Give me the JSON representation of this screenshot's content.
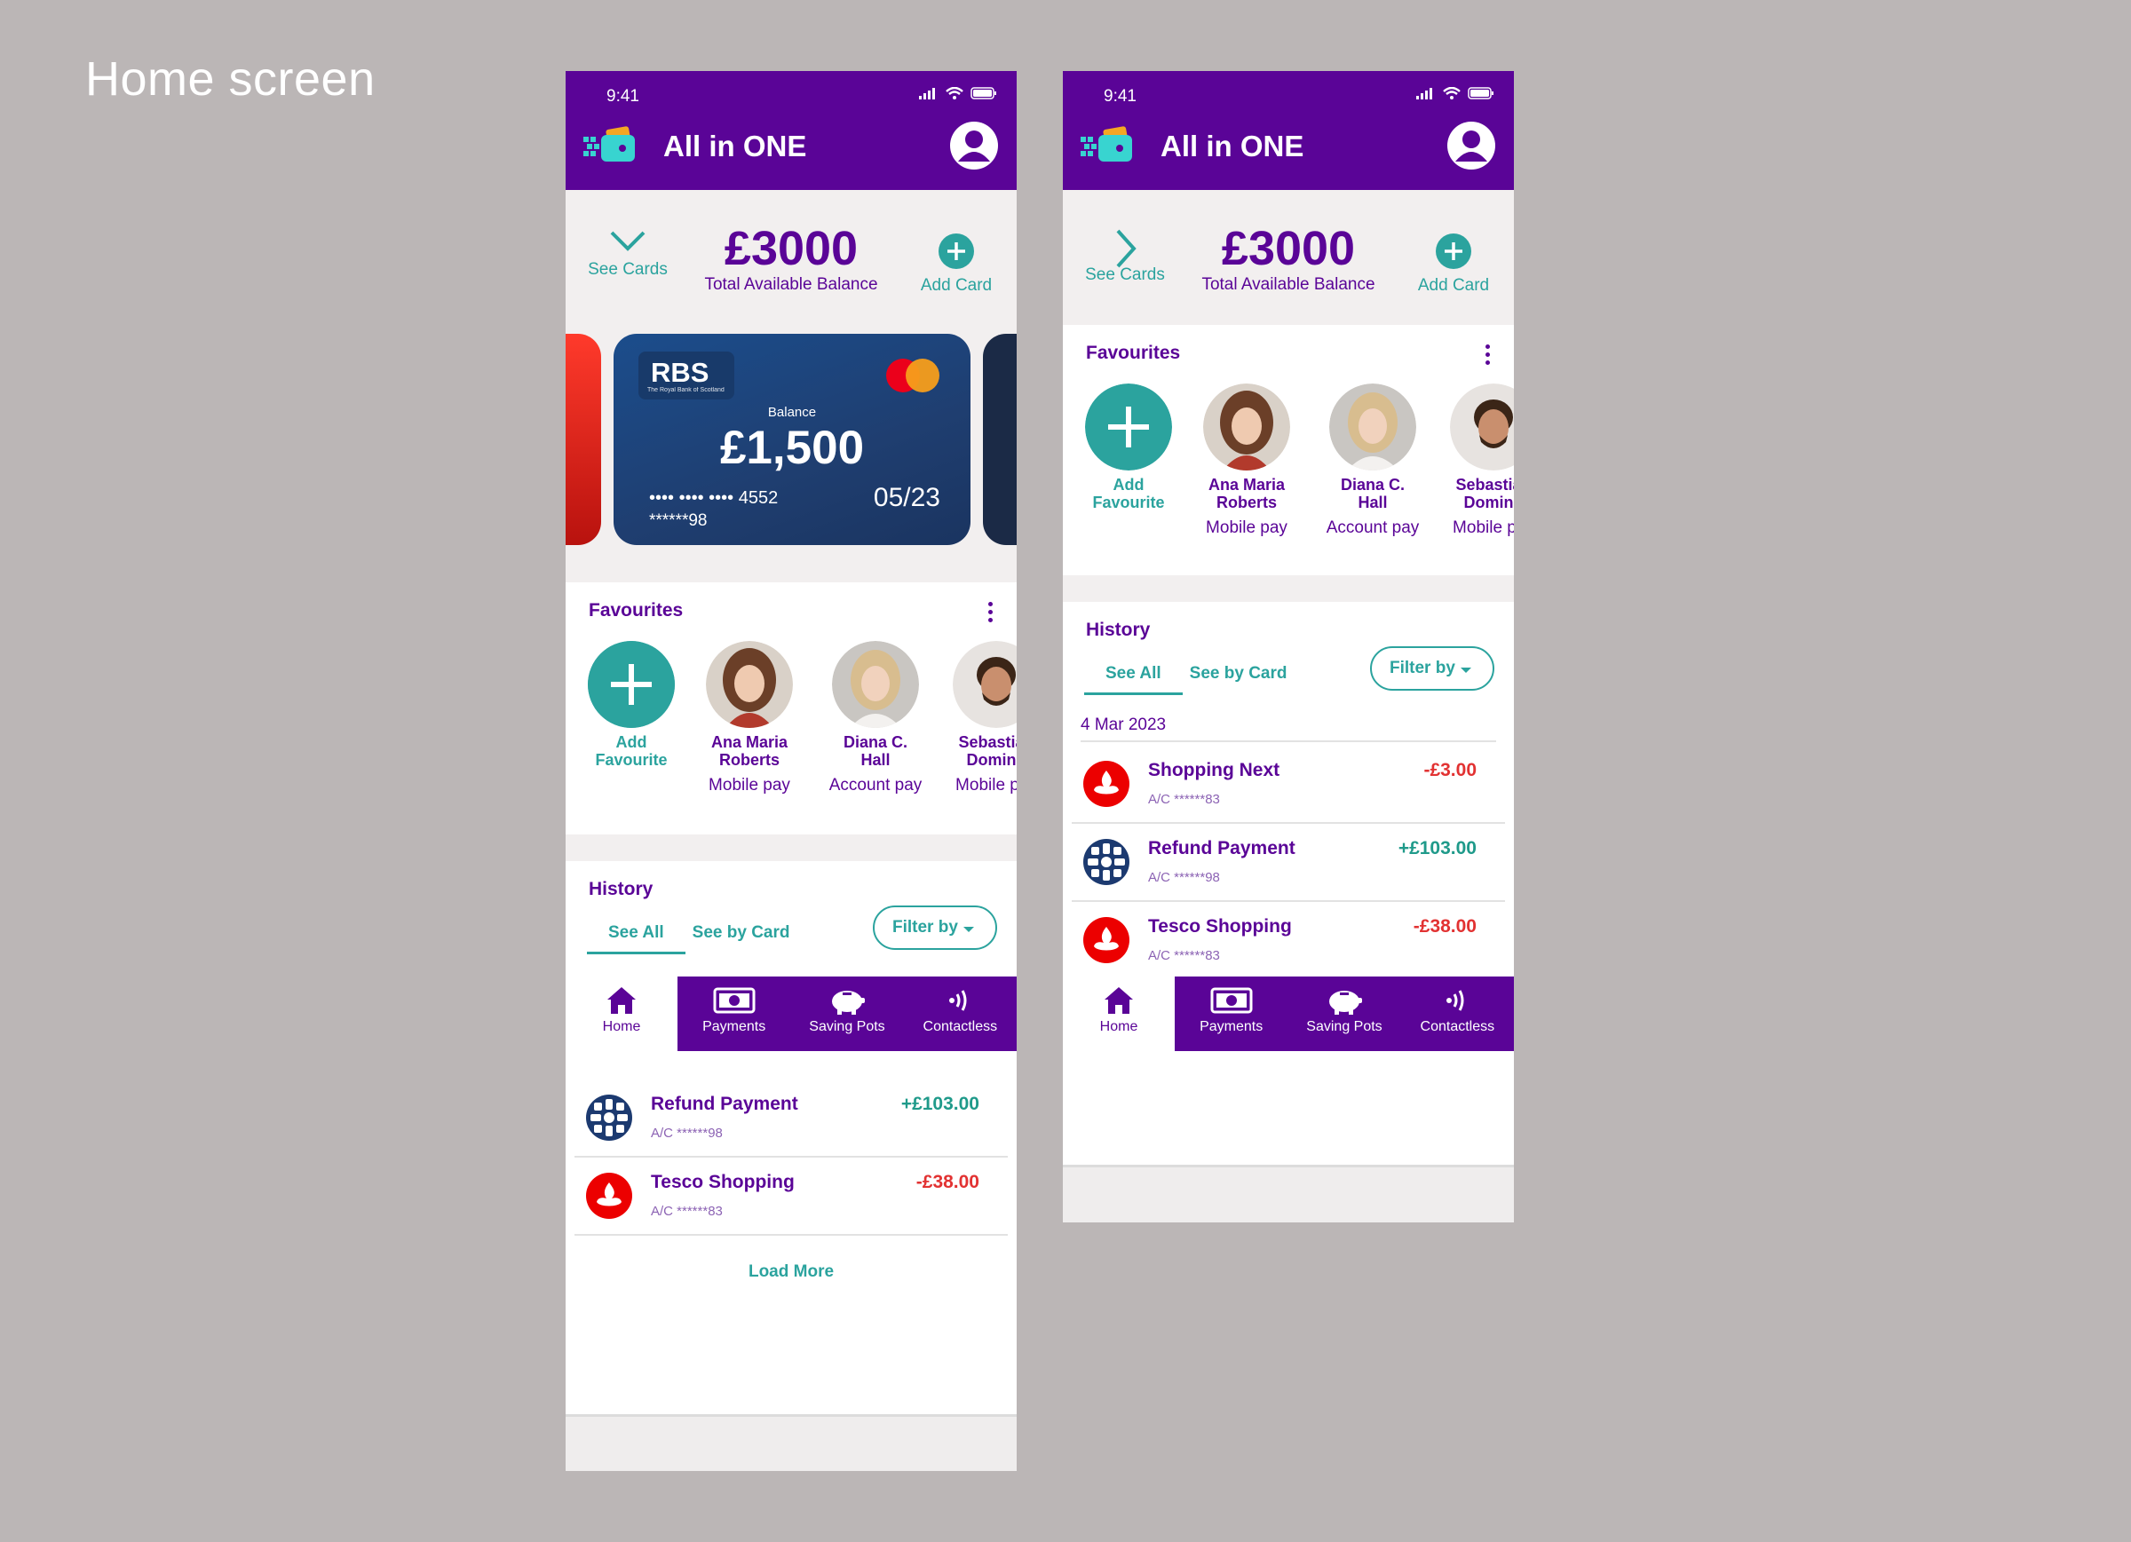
{
  "page_title": "Home screen",
  "status_time": "9:41",
  "app_title": "All in ONE",
  "balance": {
    "amount": "£3000",
    "label": "Total Available Balance"
  },
  "see_cards_label": "See Cards",
  "add_card_label": "Add Card",
  "card": {
    "bank": "RBS",
    "bank_sub": "The Royal Bank of Scotland",
    "balance_label": "Balance",
    "balance": "£1,500",
    "number": "•••• •••• •••• 4552",
    "sort": "******98",
    "expiry": "05/23"
  },
  "favourites": {
    "title": "Favourites",
    "add_label_1": "Add",
    "add_label_2": "Favourite",
    "people": [
      {
        "name_1": "Ana Maria",
        "name_2": "Roberts",
        "type": "Mobile pay"
      },
      {
        "name_1": "Diana C.",
        "name_2": "Hall",
        "type": "Account pay"
      },
      {
        "name_1": "Sebastian",
        "name_2": "Doming",
        "type": "Mobile pay"
      }
    ]
  },
  "history": {
    "title": "History",
    "tab_all": "See All",
    "tab_card": "See by Card",
    "filter": "Filter by",
    "date": "4 Mar 2023",
    "transactions": [
      {
        "name": "Shopping Next",
        "ac": "A/C ******83",
        "amount": "-£3.00",
        "bank": "santander"
      },
      {
        "name": "Refund Payment",
        "ac": "A/C ******98",
        "amount": "+£103.00",
        "bank": "rbs"
      },
      {
        "name": "Tesco Shopping",
        "ac": "A/C ******83",
        "amount": "-£38.00",
        "bank": "santander"
      }
    ],
    "load_more": "Load More"
  },
  "nav": {
    "home": "Home",
    "payments": "Payments",
    "saving_pots": "Saving Pots",
    "contactless": "Contactless"
  },
  "colors": {
    "brand_purple": "#5a0497",
    "teal": "#2ba39e",
    "negative": "#e23232",
    "positive": "#1f9a8a"
  },
  "icons": [
    "wallet-logo-icon",
    "profile-icon",
    "chevron-down-icon",
    "chevron-right-icon",
    "plus-icon",
    "mastercard-icon",
    "kebab-icon",
    "home-icon",
    "payments-icon",
    "piggy-bank-icon",
    "contactless-icon",
    "santander-icon",
    "rbs-icon",
    "signal-icon",
    "wifi-icon",
    "battery-icon"
  ]
}
